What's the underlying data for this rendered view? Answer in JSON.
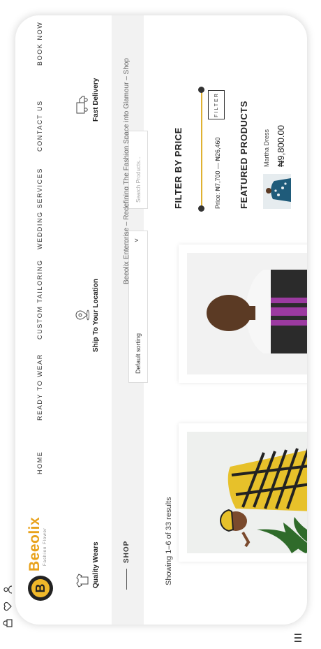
{
  "brand": {
    "name": "Beeolix",
    "tagline": "Fashion Flower",
    "logo_letter": "B",
    "accent": "#e8a21c",
    "logo_bg": "#f0b82a"
  },
  "nav": [
    {
      "label": "HOME"
    },
    {
      "label": "READY TO WEAR"
    },
    {
      "label": "CUSTOM TAILORING"
    },
    {
      "label": "WEDDING SERVICES"
    },
    {
      "label": "CONTACT US"
    },
    {
      "label": "BOOK NOW"
    }
  ],
  "features": [
    {
      "label": "Quality Wears",
      "icon": "shirt-icon"
    },
    {
      "label": "Ship To Your Location",
      "icon": "location-icon"
    },
    {
      "label": "Fast Delivery",
      "icon": "truck-icon"
    }
  ],
  "breadcrumb": {
    "title": "SHOP",
    "path": "Beeolix Enterprise – Redefining The Fashion Space into Glamour  –  Shop"
  },
  "results": {
    "text": "Showing 1–6 of 33 results"
  },
  "sort": {
    "label": "Default sorting",
    "chevron": "˅"
  },
  "search": {
    "placeholder": "Search Products..."
  },
  "filter": {
    "title": "FILTER BY PRICE",
    "price_text": "Price: ₦7,700 — ₦26,460",
    "button_label": "FILTER"
  },
  "featured": {
    "title": "FEATURED PRODUCTS",
    "item_name": "Martha Dress",
    "item_price": "₦9,800.00"
  },
  "icons": {
    "left_top": "lock-icon",
    "left_mid": "heart-icon",
    "left_bot": "user-icon",
    "menu": "menu-icon"
  }
}
